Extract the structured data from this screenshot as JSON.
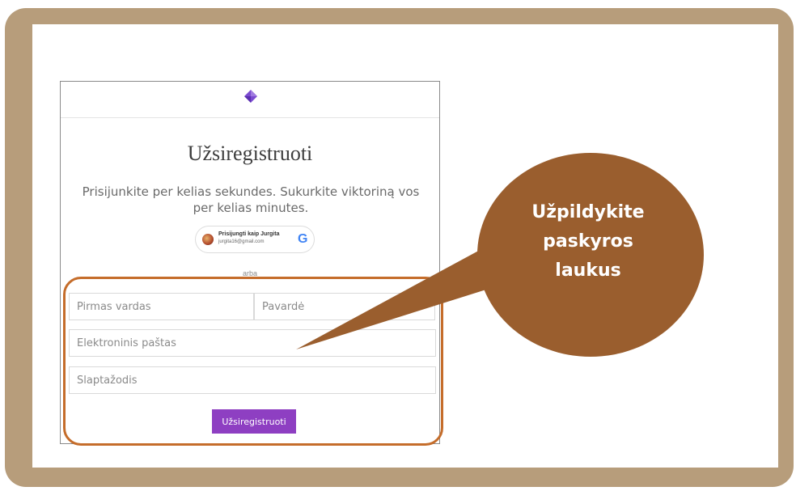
{
  "form": {
    "title": "Užsiregistruoti",
    "subtitle": "Prisijunkite per kelias sekundes. Sukurkite viktoriną vos per kelias minutes.",
    "google": {
      "name": "Prisijungti kaip Jurgita",
      "email": "jurgita16@gmail.com",
      "icon": "google-icon"
    },
    "separator": "arba",
    "fields": {
      "first_name_placeholder": "Pirmas vardas",
      "last_name_placeholder": "Pavardė",
      "email_placeholder": "Elektroninis paštas",
      "password_placeholder": "Slaptažodis"
    },
    "submit_label": "Užsiregistruoti"
  },
  "callout": {
    "text": "Užpildykite paskyros laukus"
  },
  "colors": {
    "frame": "#b79d7b",
    "bubble": "#9a5e2e",
    "highlight": "#c56d2b",
    "submit": "#8e3fc2"
  }
}
